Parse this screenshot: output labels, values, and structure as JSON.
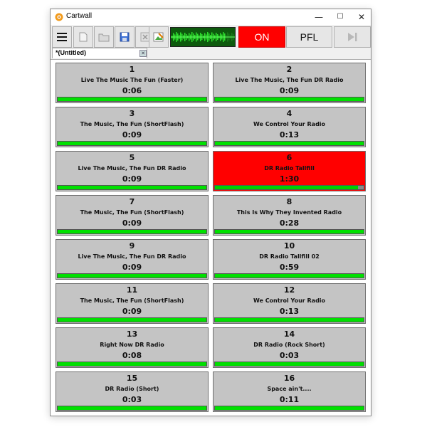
{
  "window": {
    "title": "Cartwall",
    "minimize": "—",
    "maximize": "☐",
    "close": "✕"
  },
  "toolbar": {
    "on_label": "ON",
    "pfl_label": "PFL",
    "meter_level": 0.85
  },
  "tab": {
    "label": "*(Untitled)"
  },
  "colors": {
    "playing": "#ff0000",
    "idle": "#c4c4c4",
    "progress": "#00e000"
  },
  "carts": [
    {
      "number": "1",
      "title": "Live The Music The Fun (Faster)",
      "duration": "0:06",
      "state": "idle",
      "progress": 1.0
    },
    {
      "number": "2",
      "title": "Live The Music, The Fun DR Radio",
      "duration": "0:09",
      "state": "idle",
      "progress": 1.0
    },
    {
      "number": "3",
      "title": "The Music, The Fun (ShortFlash)",
      "duration": "0:09",
      "state": "idle",
      "progress": 1.0
    },
    {
      "number": "4",
      "title": "We Control Your Radio",
      "duration": "0:13",
      "state": "idle",
      "progress": 1.0
    },
    {
      "number": "5",
      "title": "Live The Music, The Fun DR Radio",
      "duration": "0:09",
      "state": "idle",
      "progress": 1.0
    },
    {
      "number": "6",
      "title": "DR Radio Tallfill",
      "duration": "1:30",
      "state": "playing",
      "progress": 0.96
    },
    {
      "number": "7",
      "title": "The Music, The Fun (ShortFlash)",
      "duration": "0:09",
      "state": "idle",
      "progress": 1.0
    },
    {
      "number": "8",
      "title": "This Is Why They Invented Radio",
      "duration": "0:28",
      "state": "idle",
      "progress": 1.0
    },
    {
      "number": "9",
      "title": "Live The Music, The Fun DR Radio",
      "duration": "0:09",
      "state": "idle",
      "progress": 1.0
    },
    {
      "number": "10",
      "title": "DR Radio Tallfill 02",
      "duration": "0:59",
      "state": "idle",
      "progress": 1.0
    },
    {
      "number": "11",
      "title": "The Music, The Fun (ShortFlash)",
      "duration": "0:09",
      "state": "idle",
      "progress": 1.0
    },
    {
      "number": "12",
      "title": "We Control Your Radio",
      "duration": "0:13",
      "state": "idle",
      "progress": 1.0
    },
    {
      "number": "13",
      "title": "Right Now DR Radio",
      "duration": "0:08",
      "state": "idle",
      "progress": 1.0
    },
    {
      "number": "14",
      "title": "DR Radio (Rock Short)",
      "duration": "0:03",
      "state": "idle",
      "progress": 1.0
    },
    {
      "number": "15",
      "title": "DR Radio (Short)",
      "duration": "0:03",
      "state": "idle",
      "progress": 1.0
    },
    {
      "number": "16",
      "title": "Space ain't....",
      "duration": "0:11",
      "state": "idle",
      "progress": 1.0
    }
  ]
}
